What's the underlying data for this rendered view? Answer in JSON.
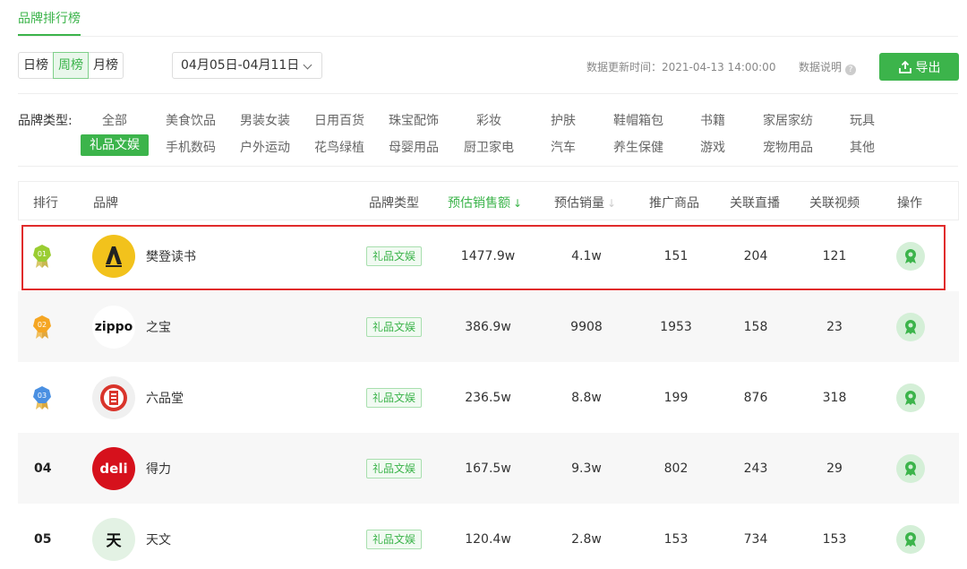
{
  "page": {
    "tab_title": "品牌排行榜"
  },
  "toolbar": {
    "periods": [
      "日榜",
      "周榜",
      "月榜"
    ],
    "active_period": "周榜",
    "date_range": "04月05日-04月11日",
    "update_time": "数据更新时间：2021-04-13 14:00:00",
    "data_desc": "数据说明",
    "export_label": "导出"
  },
  "categories": {
    "label": "品牌类型:",
    "row1": [
      "全部",
      "美食饮品",
      "男装女装",
      "日用百货",
      "珠宝配饰",
      "彩妆",
      "护肤",
      "鞋帽箱包",
      "书籍",
      "家居家纺",
      "玩具"
    ],
    "row2": [
      "礼品文娱",
      "手机数码",
      "户外运动",
      "花鸟绿植",
      "母婴用品",
      "厨卫家电",
      "汽车",
      "养生保健",
      "游戏",
      "宠物用品",
      "其他"
    ],
    "active": "礼品文娱"
  },
  "table": {
    "headers": {
      "rank": "排行",
      "brand": "品牌",
      "type": "品牌类型",
      "sales_amount": "预估销售额",
      "sales_volume": "预估销量",
      "products": "推广商品",
      "live": "关联直播",
      "videos": "关联视频",
      "action": "操作"
    },
    "rows": [
      {
        "rank": "01",
        "brand": "樊登读书",
        "type": "礼品文娱",
        "sales_amount": "1477.9w",
        "sales_volume": "4.1w",
        "products": "151",
        "live": "204",
        "videos": "121",
        "logo_text": ""
      },
      {
        "rank": "02",
        "brand": "之宝",
        "type": "礼品文娱",
        "sales_amount": "386.9w",
        "sales_volume": "9908",
        "products": "1953",
        "live": "158",
        "videos": "23",
        "logo_text": "zippo"
      },
      {
        "rank": "03",
        "brand": "六品堂",
        "type": "礼品文娱",
        "sales_amount": "236.5w",
        "sales_volume": "8.8w",
        "products": "199",
        "live": "876",
        "videos": "318",
        "logo_text": ""
      },
      {
        "rank": "04",
        "brand": "得力",
        "type": "礼品文娱",
        "sales_amount": "167.5w",
        "sales_volume": "9.3w",
        "products": "802",
        "live": "243",
        "videos": "29",
        "logo_text": "deli"
      },
      {
        "rank": "05",
        "brand": "天文",
        "type": "礼品文娱",
        "sales_amount": "120.4w",
        "sales_volume": "2.8w",
        "products": "153",
        "live": "734",
        "videos": "153",
        "logo_text": "天"
      }
    ]
  },
  "colors": {
    "accent": "#3cb44b",
    "highlight": "#e02b2b",
    "gold": "#9acd32",
    "orange": "#f5a623",
    "blue": "#4a90e2"
  }
}
